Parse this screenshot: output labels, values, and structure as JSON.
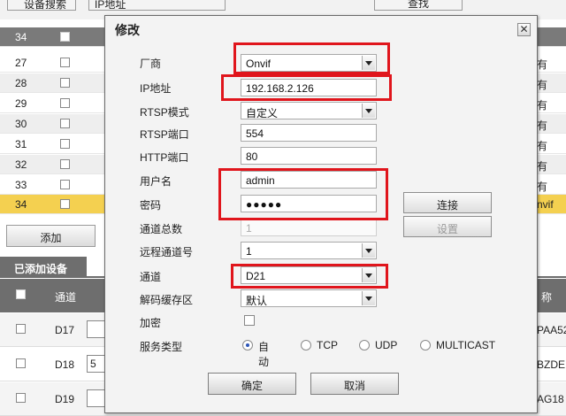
{
  "background": {
    "top_field_1": "设备搜索",
    "top_field_2": "IP地址",
    "top_button": "查找",
    "header_row_number": "34",
    "rows": [
      {
        "number": "27",
        "right_text": "有"
      },
      {
        "number": "28",
        "right_text": "有"
      },
      {
        "number": "29",
        "right_text": "有"
      },
      {
        "number": "30",
        "right_text": "有"
      },
      {
        "number": "31",
        "right_text": "有"
      },
      {
        "number": "32",
        "right_text": "有"
      },
      {
        "number": "33",
        "right_text": "有"
      },
      {
        "number": "34",
        "right_text": "nvif"
      }
    ],
    "add_button": "添加",
    "added_devices_tab": "已添加设备",
    "device_header_channel": "通道",
    "device_header_name": "称",
    "device_rows": [
      {
        "channel": "D17",
        "right_text": "PAA52",
        "box_text": ""
      },
      {
        "channel": "D18",
        "right_text": "BZDE",
        "box_text": "5"
      },
      {
        "channel": "D19",
        "right_text": "AG18",
        "box_text": ""
      }
    ]
  },
  "dialog": {
    "title": "修改",
    "close_icon": "close-icon",
    "fields": {
      "manufacturer": {
        "label": "厂商",
        "value": "Onvif"
      },
      "ip": {
        "label": "IP地址",
        "value": "192.168.2.126"
      },
      "rtsp_mode": {
        "label": "RTSP模式",
        "value": "自定义"
      },
      "rtsp_port": {
        "label": "RTSP端口",
        "value": "554"
      },
      "http_port": {
        "label": "HTTP端口",
        "value": "80"
      },
      "username": {
        "label": "用户名",
        "value": "admin"
      },
      "password": {
        "label": "密码",
        "value": "●●●●●"
      },
      "channel_total": {
        "label": "通道总数",
        "value": "1"
      },
      "remote_channel": {
        "label": "远程通道号",
        "value": "1"
      },
      "channel": {
        "label": "通道",
        "value": "D21"
      },
      "decode_buffer": {
        "label": "解码缓存区",
        "value": "默认"
      },
      "encrypt": {
        "label": "加密"
      },
      "service_type": {
        "label": "服务类型",
        "options": [
          "自动",
          "TCP",
          "UDP",
          "MULTICAST"
        ],
        "selected": "自动"
      }
    },
    "connect_button": "连接",
    "settings_button": "设置",
    "ok_button": "确定",
    "cancel_button": "取消"
  },
  "highlight_color": "#e0151c"
}
